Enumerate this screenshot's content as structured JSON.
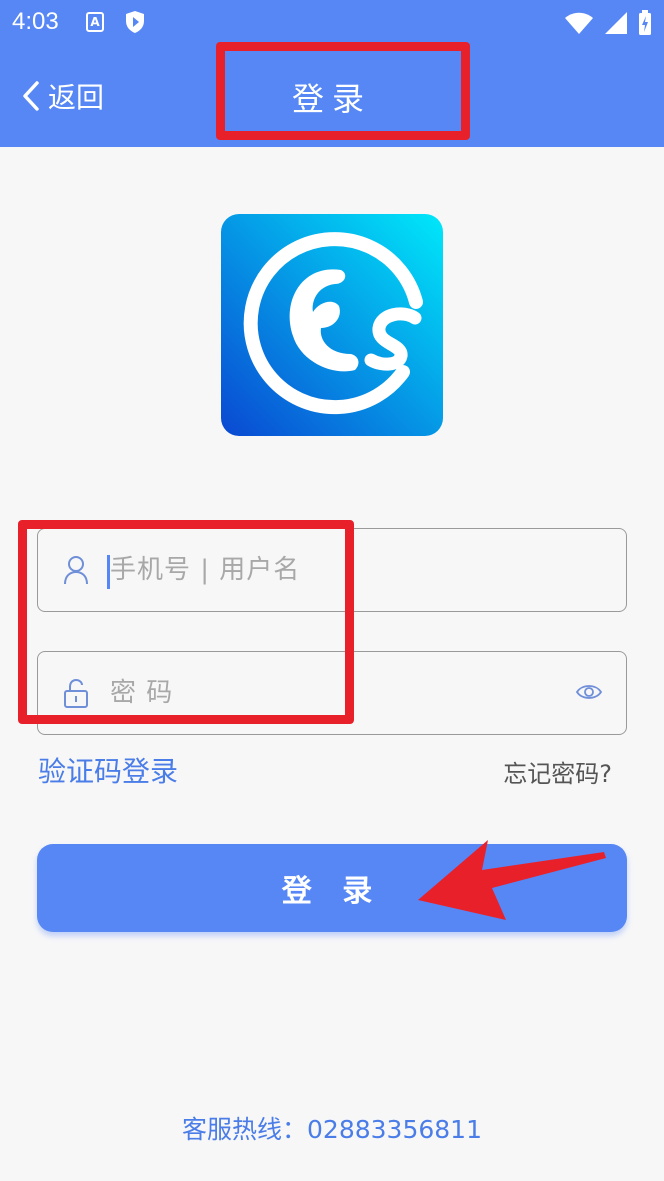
{
  "status_bar": {
    "time": "4:03",
    "a_icon_letter": "A",
    "icons": [
      "a-notification-icon",
      "shield-icon",
      "wifi-icon",
      "signal-icon",
      "battery-icon"
    ]
  },
  "nav": {
    "back_label": "返回",
    "title": "登录"
  },
  "logo": {
    "name": "app-logo",
    "colors": [
      "#00e0f8",
      "#0a4fd6"
    ]
  },
  "form": {
    "username_placeholder": "手机号 | 用户名",
    "password_placeholder": "密 码",
    "sms_login_link": "验证码登录",
    "forgot_password_link": "忘记密码?",
    "login_button": "登 录"
  },
  "footer": {
    "hotline": "客服热线：02883356811"
  },
  "colors": {
    "primary": "#5687f5",
    "link": "#4a7de8",
    "annotation": "#e8202a"
  }
}
